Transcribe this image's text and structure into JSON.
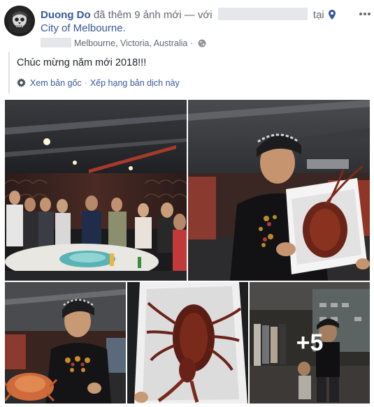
{
  "post": {
    "author": "Duong Do",
    "action_text": "đã thêm 9 ảnh mới — với",
    "location_prefix": "tại",
    "location": "City of Melbourne.",
    "place_text": "Melbourne, Victoria, Australia",
    "separator": "·",
    "message": "Chúc mừng năm mới 2018!!!",
    "see_original": "Xem bản gốc",
    "rate_translation": "Xếp hạng bản dịch này",
    "more_photos_label": "+5"
  },
  "icons": {
    "location_pin": "location-pin-icon",
    "privacy": "globe-icon",
    "translation": "gear-icon",
    "options": "more-options-icon"
  },
  "colors": {
    "link": "#365899",
    "muted": "#616770",
    "text": "#1d2129"
  }
}
